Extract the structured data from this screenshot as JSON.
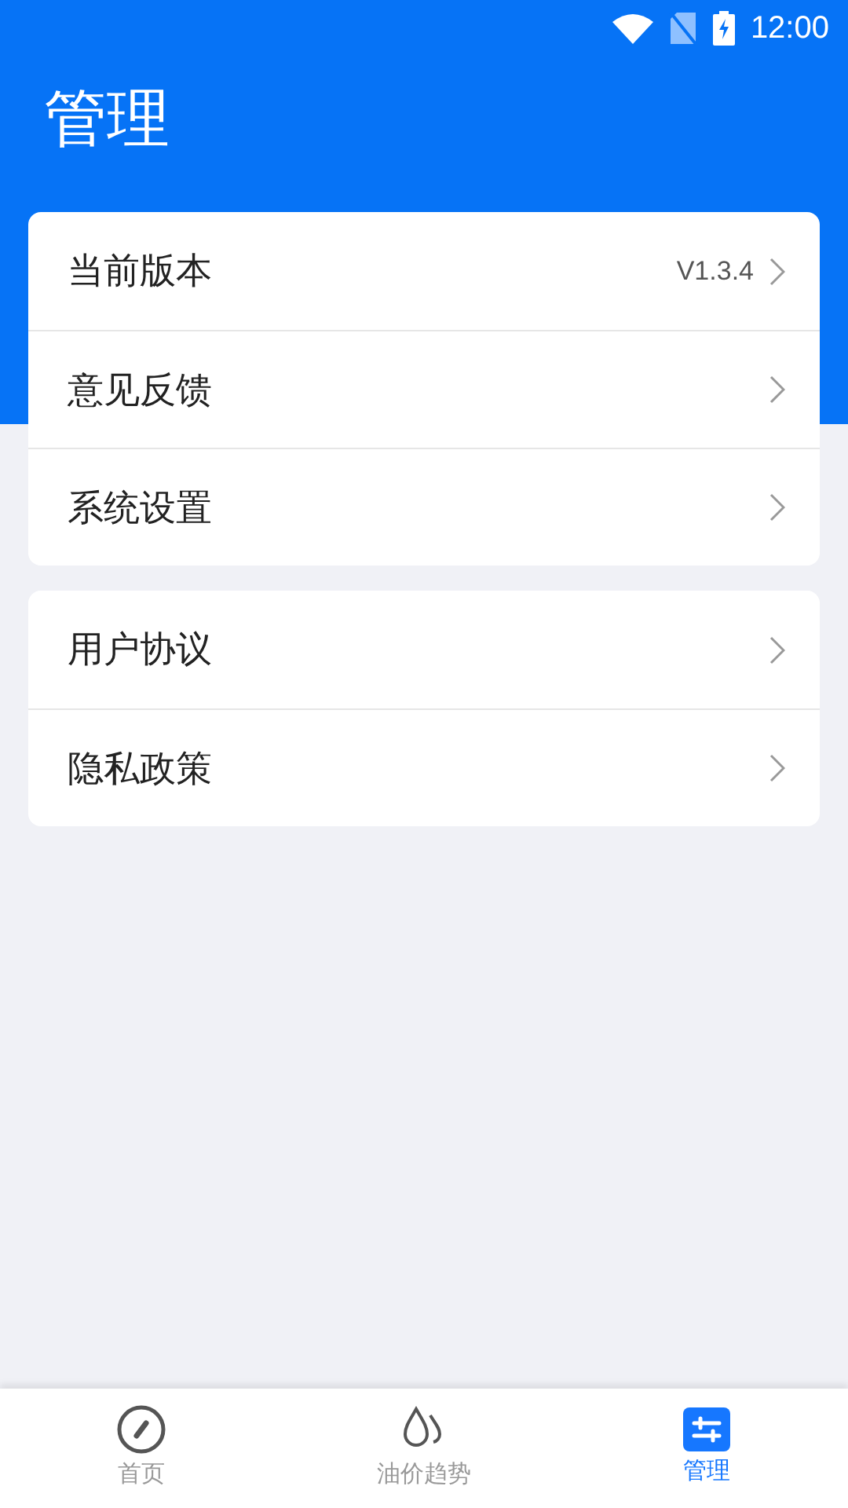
{
  "status_bar": {
    "time": "12:00"
  },
  "header": {
    "title": "管理"
  },
  "groups": [
    {
      "items": [
        {
          "label": "当前版本",
          "value": "V1.3.4"
        },
        {
          "label": "意见反馈"
        },
        {
          "label": "系统设置"
        }
      ]
    },
    {
      "items": [
        {
          "label": "用户协议"
        },
        {
          "label": "隐私政策"
        }
      ]
    }
  ],
  "bottom_nav": [
    {
      "label": "首页",
      "kind": "compass",
      "selected": false
    },
    {
      "label": "油价趋势",
      "kind": "drops",
      "selected": false
    },
    {
      "label": "管理",
      "kind": "sliders",
      "selected": true
    }
  ]
}
